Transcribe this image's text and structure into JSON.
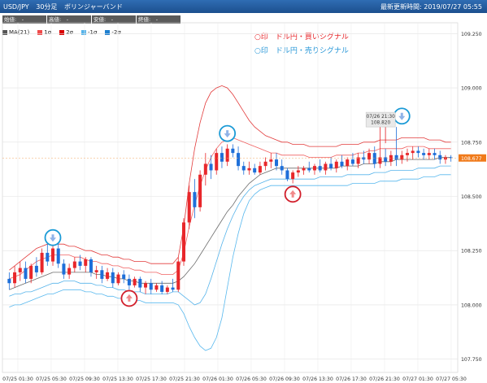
{
  "header": {
    "symbol": "USD/JPY",
    "timeframe": "30分足",
    "indicator": "ボリンジャーバンド",
    "updated_label": "最新更新時間:",
    "updated_time": "2019/07/27 05:55"
  },
  "ohlc_fields": [
    "始値:　-",
    "高値:　-",
    "安値:　-",
    "終値:　-"
  ],
  "legend": [
    {
      "label": "MA(21)",
      "color": "#555555"
    },
    {
      "label": "1σ",
      "color": "#f04a4a"
    },
    {
      "label": "2σ",
      "color": "#d90000"
    },
    {
      "label": "-1σ",
      "color": "#55b3ea"
    },
    {
      "label": "-2σ",
      "color": "#1e7fd0"
    }
  ],
  "signals": {
    "buy": "○印　ドル円・買いシグナル",
    "sell": "○印　ドル円・売りシグナル"
  },
  "colors": {
    "up": "#e8272b",
    "down": "#1e6fd9",
    "ma": "#6b6b6b",
    "band1_upper": "#f06060",
    "band2_upper": "#e23a3a",
    "band1_lower": "#55b3ea",
    "band2_lower": "#58b8ee",
    "buy_circle": "#d21f2b",
    "sell_circle": "#1a9ad6",
    "last_price_bg": "#f07a1a"
  },
  "chart_data": {
    "type": "candlestick",
    "ylim": [
      107.7,
      109.3
    ],
    "y_ticks": [
      "109.250",
      "109.000",
      "108.750",
      "108.500",
      "108.250",
      "108.000",
      "107.750"
    ],
    "x_ticks": [
      "07/25 01:30",
      "07/25 05:30",
      "07/25 09:30",
      "07/25 13:30",
      "07/25 17:30",
      "07/25 21:30",
      "07/26 01:30",
      "07/26 05:30",
      "07/26 09:30",
      "07/26 13:30",
      "07/26 17:30",
      "07/26 21:30",
      "07/27 01:30",
      "07/27 05:30"
    ],
    "last_price": "108.677",
    "tooltip": {
      "time": "07/26 21:30",
      "price": "108.820"
    },
    "candles": [
      {
        "o": 108.12,
        "h": 108.15,
        "l": 108.07,
        "c": 108.1
      },
      {
        "o": 108.1,
        "h": 108.18,
        "l": 108.08,
        "c": 108.15
      },
      {
        "o": 108.15,
        "h": 108.2,
        "l": 108.11,
        "c": 108.17
      },
      {
        "o": 108.17,
        "h": 108.2,
        "l": 108.1,
        "c": 108.12
      },
      {
        "o": 108.12,
        "h": 108.19,
        "l": 108.1,
        "c": 108.18
      },
      {
        "o": 108.18,
        "h": 108.22,
        "l": 108.13,
        "c": 108.15
      },
      {
        "o": 108.15,
        "h": 108.26,
        "l": 108.14,
        "c": 108.24
      },
      {
        "o": 108.24,
        "h": 108.28,
        "l": 108.18,
        "c": 108.2
      },
      {
        "o": 108.2,
        "h": 108.29,
        "l": 108.18,
        "c": 108.26
      },
      {
        "o": 108.26,
        "h": 108.29,
        "l": 108.17,
        "c": 108.19
      },
      {
        "o": 108.19,
        "h": 108.21,
        "l": 108.12,
        "c": 108.14
      },
      {
        "o": 108.14,
        "h": 108.19,
        "l": 108.12,
        "c": 108.17
      },
      {
        "o": 108.17,
        "h": 108.22,
        "l": 108.15,
        "c": 108.2
      },
      {
        "o": 108.2,
        "h": 108.23,
        "l": 108.16,
        "c": 108.18
      },
      {
        "o": 108.18,
        "h": 108.22,
        "l": 108.15,
        "c": 108.21
      },
      {
        "o": 108.21,
        "h": 108.22,
        "l": 108.13,
        "c": 108.15
      },
      {
        "o": 108.15,
        "h": 108.18,
        "l": 108.12,
        "c": 108.16
      },
      {
        "o": 108.16,
        "h": 108.18,
        "l": 108.1,
        "c": 108.12
      },
      {
        "o": 108.12,
        "h": 108.17,
        "l": 108.11,
        "c": 108.15
      },
      {
        "o": 108.15,
        "h": 108.17,
        "l": 108.08,
        "c": 108.1
      },
      {
        "o": 108.1,
        "h": 108.15,
        "l": 108.09,
        "c": 108.14
      },
      {
        "o": 108.14,
        "h": 108.16,
        "l": 108.1,
        "c": 108.12
      },
      {
        "o": 108.12,
        "h": 108.14,
        "l": 108.07,
        "c": 108.09
      },
      {
        "o": 108.09,
        "h": 108.13,
        "l": 108.08,
        "c": 108.12
      },
      {
        "o": 108.12,
        "h": 108.13,
        "l": 108.06,
        "c": 108.08
      },
      {
        "o": 108.08,
        "h": 108.11,
        "l": 108.05,
        "c": 108.1
      },
      {
        "o": 108.1,
        "h": 108.12,
        "l": 108.05,
        "c": 108.07
      },
      {
        "o": 108.07,
        "h": 108.1,
        "l": 108.06,
        "c": 108.09
      },
      {
        "o": 108.09,
        "h": 108.11,
        "l": 108.05,
        "c": 108.06
      },
      {
        "o": 108.06,
        "h": 108.09,
        "l": 108.05,
        "c": 108.08
      },
      {
        "o": 108.08,
        "h": 108.12,
        "l": 108.06,
        "c": 108.07
      },
      {
        "o": 108.07,
        "h": 108.22,
        "l": 108.06,
        "c": 108.2
      },
      {
        "o": 108.2,
        "h": 108.4,
        "l": 108.18,
        "c": 108.38
      },
      {
        "o": 108.38,
        "h": 108.55,
        "l": 108.35,
        "c": 108.52
      },
      {
        "o": 108.52,
        "h": 108.58,
        "l": 108.4,
        "c": 108.45
      },
      {
        "o": 108.45,
        "h": 108.62,
        "l": 108.43,
        "c": 108.6
      },
      {
        "o": 108.6,
        "h": 108.7,
        "l": 108.55,
        "c": 108.65
      },
      {
        "o": 108.65,
        "h": 108.69,
        "l": 108.58,
        "c": 108.62
      },
      {
        "o": 108.62,
        "h": 108.72,
        "l": 108.6,
        "c": 108.7
      },
      {
        "o": 108.7,
        "h": 108.73,
        "l": 108.63,
        "c": 108.66
      },
      {
        "o": 108.66,
        "h": 108.74,
        "l": 108.64,
        "c": 108.72
      },
      {
        "o": 108.72,
        "h": 108.74,
        "l": 108.68,
        "c": 108.7
      },
      {
        "o": 108.7,
        "h": 108.73,
        "l": 108.62,
        "c": 108.64
      },
      {
        "o": 108.64,
        "h": 108.66,
        "l": 108.6,
        "c": 108.62
      },
      {
        "o": 108.62,
        "h": 108.66,
        "l": 108.6,
        "c": 108.63
      },
      {
        "o": 108.63,
        "h": 108.65,
        "l": 108.6,
        "c": 108.61
      },
      {
        "o": 108.61,
        "h": 108.66,
        "l": 108.6,
        "c": 108.64
      },
      {
        "o": 108.64,
        "h": 108.68,
        "l": 108.62,
        "c": 108.66
      },
      {
        "o": 108.66,
        "h": 108.7,
        "l": 108.63,
        "c": 108.67
      },
      {
        "o": 108.67,
        "h": 108.7,
        "l": 108.62,
        "c": 108.64
      },
      {
        "o": 108.64,
        "h": 108.67,
        "l": 108.6,
        "c": 108.62
      },
      {
        "o": 108.62,
        "h": 108.63,
        "l": 108.57,
        "c": 108.58
      },
      {
        "o": 108.58,
        "h": 108.62,
        "l": 108.56,
        "c": 108.61
      },
      {
        "o": 108.61,
        "h": 108.64,
        "l": 108.59,
        "c": 108.62
      },
      {
        "o": 108.62,
        "h": 108.64,
        "l": 108.6,
        "c": 108.63
      },
      {
        "o": 108.63,
        "h": 108.66,
        "l": 108.61,
        "c": 108.62
      },
      {
        "o": 108.62,
        "h": 108.65,
        "l": 108.6,
        "c": 108.64
      },
      {
        "o": 108.64,
        "h": 108.67,
        "l": 108.61,
        "c": 108.62
      },
      {
        "o": 108.62,
        "h": 108.66,
        "l": 108.6,
        "c": 108.65
      },
      {
        "o": 108.65,
        "h": 108.68,
        "l": 108.62,
        "c": 108.63
      },
      {
        "o": 108.63,
        "h": 108.67,
        "l": 108.61,
        "c": 108.66
      },
      {
        "o": 108.66,
        "h": 108.69,
        "l": 108.63,
        "c": 108.64
      },
      {
        "o": 108.64,
        "h": 108.68,
        "l": 108.62,
        "c": 108.67
      },
      {
        "o": 108.67,
        "h": 108.7,
        "l": 108.64,
        "c": 108.65
      },
      {
        "o": 108.65,
        "h": 108.7,
        "l": 108.63,
        "c": 108.68
      },
      {
        "o": 108.68,
        "h": 108.71,
        "l": 108.65,
        "c": 108.67
      },
      {
        "o": 108.67,
        "h": 108.72,
        "l": 108.65,
        "c": 108.7
      },
      {
        "o": 108.7,
        "h": 108.73,
        "l": 108.63,
        "c": 108.65
      },
      {
        "o": 108.65,
        "h": 108.82,
        "l": 108.63,
        "c": 108.68
      },
      {
        "o": 108.68,
        "h": 108.72,
        "l": 108.64,
        "c": 108.66
      },
      {
        "o": 108.66,
        "h": 108.71,
        "l": 108.64,
        "c": 108.69
      },
      {
        "o": 108.69,
        "h": 108.82,
        "l": 108.64,
        "c": 108.67
      },
      {
        "o": 108.67,
        "h": 108.71,
        "l": 108.65,
        "c": 108.69
      },
      {
        "o": 108.69,
        "h": 108.72,
        "l": 108.66,
        "c": 108.7
      },
      {
        "o": 108.7,
        "h": 108.73,
        "l": 108.67,
        "c": 108.71
      },
      {
        "o": 108.71,
        "h": 108.73,
        "l": 108.68,
        "c": 108.7
      },
      {
        "o": 108.7,
        "h": 108.72,
        "l": 108.67,
        "c": 108.69
      },
      {
        "o": 108.69,
        "h": 108.72,
        "l": 108.67,
        "c": 108.7
      },
      {
        "o": 108.7,
        "h": 108.72,
        "l": 108.67,
        "c": 108.69
      },
      {
        "o": 108.69,
        "h": 108.71,
        "l": 108.65,
        "c": 108.67
      },
      {
        "o": 108.67,
        "h": 108.69,
        "l": 108.65,
        "c": 108.68
      },
      {
        "o": 108.68,
        "h": 108.69,
        "l": 108.66,
        "c": 108.677
      }
    ],
    "bands": {
      "ma": [
        108.07,
        108.08,
        108.09,
        108.1,
        108.11,
        108.12,
        108.13,
        108.14,
        108.15,
        108.15,
        108.15,
        108.15,
        108.15,
        108.15,
        108.15,
        108.15,
        108.14,
        108.14,
        108.13,
        108.13,
        108.12,
        108.12,
        108.11,
        108.11,
        108.1,
        108.1,
        108.1,
        108.1,
        108.1,
        108.1,
        108.1,
        108.11,
        108.13,
        108.16,
        108.19,
        108.23,
        108.27,
        108.31,
        108.35,
        108.39,
        108.43,
        108.46,
        108.5,
        108.53,
        108.56,
        108.58,
        108.6,
        108.61,
        108.62,
        108.63,
        108.63,
        108.63,
        108.63,
        108.63,
        108.63,
        108.63,
        108.63,
        108.63,
        108.63,
        108.63,
        108.63,
        108.64,
        108.64,
        108.64,
        108.64,
        108.65,
        108.65,
        108.65,
        108.66,
        108.66,
        108.66,
        108.67,
        108.67,
        108.67,
        108.67,
        108.67,
        108.67,
        108.67,
        108.67,
        108.68,
        108.68,
        108.68
      ],
      "upper1": [
        108.12,
        108.13,
        108.14,
        108.16,
        108.18,
        108.2,
        108.21,
        108.22,
        108.23,
        108.23,
        108.23,
        108.23,
        108.22,
        108.22,
        108.21,
        108.2,
        108.2,
        108.19,
        108.19,
        108.18,
        108.18,
        108.17,
        108.17,
        108.16,
        108.16,
        108.15,
        108.15,
        108.15,
        108.14,
        108.14,
        108.14,
        108.16,
        108.24,
        108.36,
        108.46,
        108.55,
        108.62,
        108.68,
        108.72,
        108.75,
        108.76,
        108.77,
        108.76,
        108.75,
        108.74,
        108.73,
        108.72,
        108.71,
        108.7,
        108.7,
        108.69,
        108.69,
        108.69,
        108.69,
        108.69,
        108.68,
        108.68,
        108.68,
        108.68,
        108.68,
        108.69,
        108.69,
        108.69,
        108.69,
        108.7,
        108.7,
        108.71,
        108.71,
        108.72,
        108.72,
        108.72,
        108.72,
        108.72,
        108.73,
        108.73,
        108.73,
        108.73,
        108.72,
        108.72,
        108.72,
        108.72,
        108.72
      ],
      "upper2": [
        108.16,
        108.18,
        108.2,
        108.22,
        108.24,
        108.26,
        108.27,
        108.28,
        108.28,
        108.28,
        108.28,
        108.27,
        108.27,
        108.26,
        108.25,
        108.25,
        108.24,
        108.23,
        108.23,
        108.22,
        108.22,
        108.21,
        108.21,
        108.2,
        108.2,
        108.2,
        108.19,
        108.19,
        108.19,
        108.19,
        108.19,
        108.22,
        108.36,
        108.56,
        108.72,
        108.84,
        108.93,
        108.98,
        109.0,
        109.01,
        109.0,
        108.97,
        108.93,
        108.89,
        108.85,
        108.82,
        108.8,
        108.78,
        108.77,
        108.76,
        108.75,
        108.75,
        108.74,
        108.74,
        108.74,
        108.73,
        108.73,
        108.73,
        108.73,
        108.73,
        108.73,
        108.74,
        108.74,
        108.74,
        108.74,
        108.75,
        108.75,
        108.75,
        108.76,
        108.76,
        108.76,
        108.76,
        108.77,
        108.77,
        108.77,
        108.77,
        108.77,
        108.76,
        108.76,
        108.76,
        108.75,
        108.75
      ],
      "lower1": [
        108.04,
        108.05,
        108.05,
        108.06,
        108.06,
        108.07,
        108.08,
        108.09,
        108.1,
        108.1,
        108.11,
        108.11,
        108.11,
        108.1,
        108.1,
        108.1,
        108.09,
        108.09,
        108.08,
        108.08,
        108.07,
        108.07,
        108.06,
        108.06,
        108.06,
        108.05,
        108.05,
        108.05,
        108.05,
        108.05,
        108.06,
        108.06,
        108.04,
        108.02,
        108.0,
        108.01,
        108.05,
        108.12,
        108.2,
        108.28,
        108.35,
        108.41,
        108.46,
        108.5,
        108.53,
        108.55,
        108.56,
        108.57,
        108.58,
        108.58,
        108.58,
        108.58,
        108.58,
        108.58,
        108.58,
        108.58,
        108.58,
        108.59,
        108.59,
        108.59,
        108.59,
        108.59,
        108.6,
        108.6,
        108.6,
        108.6,
        108.6,
        108.61,
        108.61,
        108.61,
        108.62,
        108.62,
        108.62,
        108.62,
        108.62,
        108.63,
        108.63,
        108.63,
        108.63,
        108.64,
        108.64,
        108.64
      ],
      "lower2": [
        107.99,
        108.0,
        108.0,
        108.01,
        108.02,
        108.03,
        108.04,
        108.05,
        108.05,
        108.06,
        108.07,
        108.07,
        108.07,
        108.07,
        108.06,
        108.06,
        108.05,
        108.05,
        108.04,
        108.04,
        108.03,
        108.03,
        108.03,
        108.02,
        108.02,
        108.01,
        108.01,
        108.01,
        108.01,
        108.01,
        108.01,
        108.0,
        107.96,
        107.9,
        107.85,
        107.81,
        107.79,
        107.8,
        107.85,
        107.94,
        108.08,
        108.22,
        108.33,
        108.42,
        108.48,
        108.51,
        108.53,
        108.54,
        108.55,
        108.55,
        108.55,
        108.55,
        108.55,
        108.55,
        108.55,
        108.55,
        108.55,
        108.55,
        108.55,
        108.55,
        108.55,
        108.55,
        108.55,
        108.56,
        108.56,
        108.56,
        108.56,
        108.56,
        108.57,
        108.57,
        108.57,
        108.57,
        108.58,
        108.58,
        108.58,
        108.58,
        108.59,
        108.59,
        108.59,
        108.6,
        108.6,
        108.6
      ]
    },
    "buy_markers": [
      {
        "candle": 22,
        "price": 108.03
      },
      {
        "candle": 52,
        "price": 108.51
      }
    ],
    "sell_markers": [
      {
        "candle": 8,
        "price": 108.31
      },
      {
        "candle": 40,
        "price": 108.79
      },
      {
        "candle": 72,
        "price": 108.87
      }
    ]
  }
}
